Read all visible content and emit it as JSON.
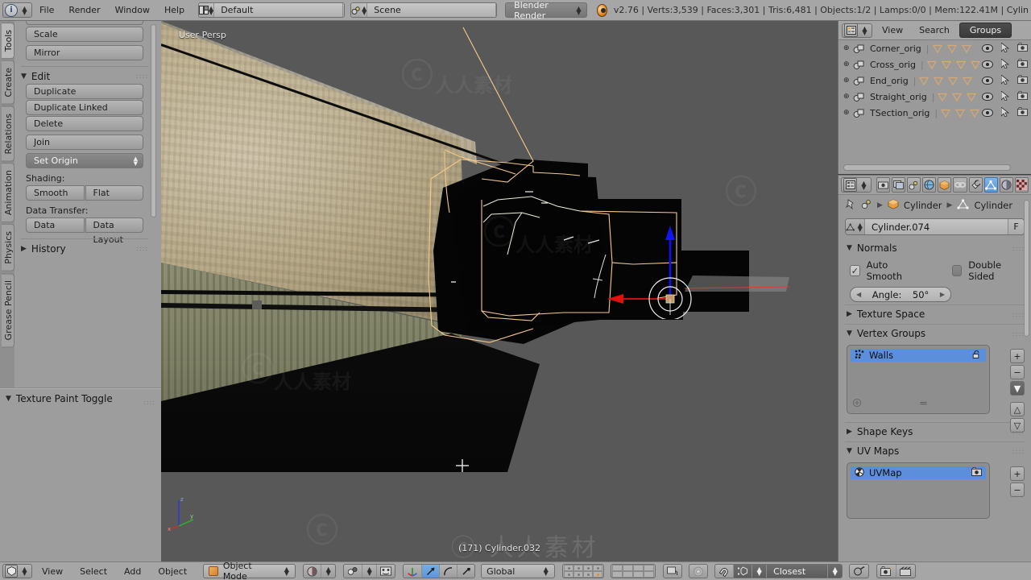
{
  "topbar": {
    "app_icon": "blender-info-icon",
    "menus": [
      "File",
      "Render",
      "Window",
      "Help"
    ],
    "screen_layout": {
      "icon": "screen-layout-icon",
      "value": "Default",
      "add": "+",
      "remove": "x"
    },
    "scene": {
      "icon": "scene-icon",
      "value": "Scene",
      "add": "+",
      "remove": "x"
    },
    "engine": {
      "value": "Blender Render",
      "icon": "dropdown-arrows-icon"
    },
    "logo": "blender-logo-icon",
    "stats": "v2.76 | Verts:3,539 | Faces:3,301 | Tris:6,481 | Objects:1/2 | Lamps:0/0 | Mem:122.41M | Cylin"
  },
  "toolshelf": {
    "tabs": [
      "Tools",
      "Create",
      "Relations",
      "Animation",
      "Physics",
      "Grease Pencil"
    ],
    "active_tab": "Tools",
    "transform_buttons": [
      "Scale",
      "Mirror"
    ],
    "edit_section": {
      "title": "Edit",
      "collapsed": false
    },
    "edit_buttons": [
      "Duplicate",
      "Duplicate Linked",
      "Delete",
      "Join"
    ],
    "set_origin": "Set Origin",
    "shading_label": "Shading:",
    "shading_buttons": [
      "Smooth",
      "Flat"
    ],
    "data_transfer_label": "Data Transfer:",
    "data_transfer_buttons": [
      "Data",
      "Data Layout"
    ],
    "history_section": {
      "title": "History",
      "collapsed": true
    },
    "bottom_panel": {
      "title": "Texture Paint Toggle",
      "collapsed": false
    }
  },
  "viewport": {
    "view_label": "User Persp",
    "object_label": "(171) Cylinder.032",
    "background_color": "#585858",
    "selection_outline_color": "#f5c98a",
    "axis_gizmo": {
      "z": "z",
      "y": "y",
      "x": "x"
    },
    "manipulator": {
      "x_axis_color": "#e01010",
      "z_axis_color": "#1111ee"
    },
    "watermark": "人人素材"
  },
  "outliner": {
    "display_mode_icon": "outliner-display-icon",
    "menus": [
      "View",
      "Search"
    ],
    "active_filter": "Groups",
    "rows": [
      {
        "name": "Corner_orig",
        "triangles": 3,
        "icons": [
          "eye-icon",
          "cursor-icon",
          "camera-icon"
        ]
      },
      {
        "name": "Cross_orig",
        "triangles": 4,
        "icons": [
          "eye-icon",
          "cursor-icon",
          "camera-icon"
        ]
      },
      {
        "name": "End_orig",
        "triangles": 4,
        "icons": [
          "eye-icon",
          "cursor-icon",
          "camera-icon"
        ]
      },
      {
        "name": "Straight_orig",
        "triangles": 3,
        "icons": [
          "eye-icon",
          "cursor-icon",
          "camera-icon"
        ]
      },
      {
        "name": "TSection_orig",
        "triangles": 3,
        "icons": [
          "eye-icon",
          "cursor-icon",
          "camera-icon"
        ]
      }
    ]
  },
  "properties": {
    "tabs": [
      {
        "name": "render-tab",
        "icon": "camera-back-icon",
        "active": false
      },
      {
        "name": "render-layers-tab",
        "icon": "images-icon",
        "active": false
      },
      {
        "name": "scene-tab",
        "icon": "scene-cone-icon",
        "active": false
      },
      {
        "name": "world-tab",
        "icon": "globe-icon",
        "active": false
      },
      {
        "name": "object-tab",
        "icon": "orange-cube-icon",
        "active": false
      },
      {
        "name": "constraints-tab",
        "icon": "chain-icon",
        "active": false
      },
      {
        "name": "modifiers-tab",
        "icon": "wrench-icon",
        "active": false
      },
      {
        "name": "data-tab",
        "icon": "green-triangle-mesh-icon",
        "active": true
      },
      {
        "name": "material-tab",
        "icon": "material-sphere-icon",
        "active": false
      },
      {
        "name": "texture-tab",
        "icon": "checker-texture-icon",
        "active": false
      }
    ],
    "breadcrumb": {
      "pin": "pin-icon",
      "scene_icon": "scene-icon",
      "object": "Cylinder",
      "data": "Cylinder"
    },
    "mesh_name": "Cylinder.074",
    "fake_user": "F",
    "normals": {
      "title": "Normals",
      "auto_smooth": {
        "label": "Auto Smooth",
        "checked": true
      },
      "double_sided": {
        "label": "Double Sided",
        "checked": false
      },
      "angle_label": "Angle:",
      "angle_value": "50°"
    },
    "texture_space": {
      "title": "Texture Space",
      "collapsed": true
    },
    "vertex_groups": {
      "title": "Vertex Groups",
      "items": [
        {
          "name": "Walls",
          "selected": true,
          "lock_icon": "unlock-icon"
        }
      ],
      "side_buttons": [
        "+",
        "−",
        "▼",
        "△",
        "▽"
      ]
    },
    "shape_keys": {
      "title": "Shape Keys",
      "collapsed": true
    },
    "uv_maps": {
      "title": "UV Maps",
      "items": [
        {
          "name": "UVMap",
          "selected": true,
          "camera_icon": "camera-icon"
        }
      ],
      "side_buttons": [
        "+",
        "−"
      ]
    }
  },
  "bottombar": {
    "editor_type_icon": "3d-view-icon",
    "menus": [
      "View",
      "Select",
      "Add",
      "Object"
    ],
    "mode": "Object Mode",
    "viewport_shading_icon": "material-shading-icon",
    "pivot_icon": "pivot-icon",
    "manipulator_toggle_icon": "manipulator-icon",
    "manipulator_modes": [
      "translate-icon",
      "rotate-icon",
      "scale-icon"
    ],
    "transform_orientation": "Global",
    "snap_mode": "Closest",
    "snap_icon": "magnet-icon",
    "proportional_icon": "proportional-edit-icon",
    "render_icon": "render-image-icon",
    "animation_icon": "render-animation-icon"
  }
}
